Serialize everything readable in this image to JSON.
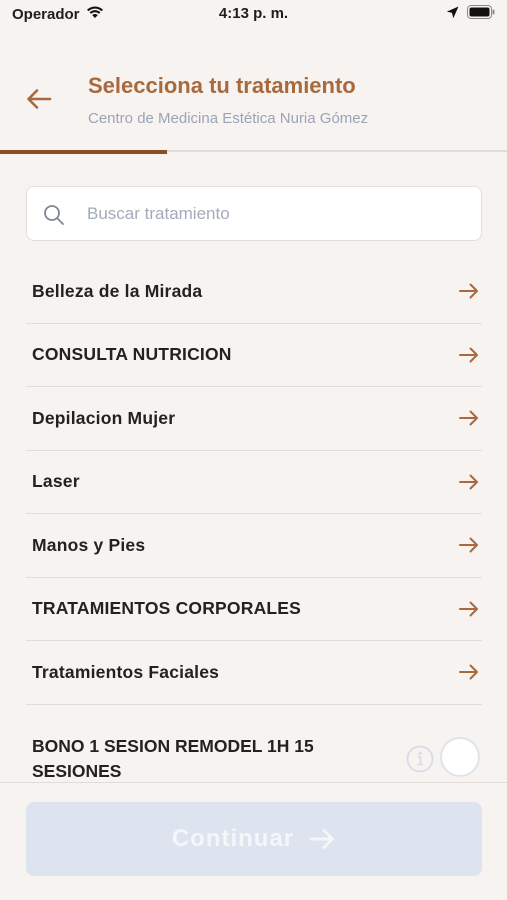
{
  "status_bar": {
    "carrier": "Operador",
    "time": "4:13 p. m."
  },
  "header": {
    "title": "Selecciona tu tratamiento",
    "subtitle": "Centro de Medicina Estética Nuria Gómez",
    "progress": 0.33
  },
  "search": {
    "placeholder": "Buscar tratamiento",
    "value": ""
  },
  "categories": [
    {
      "label": "Belleza de la Mirada"
    },
    {
      "label": "CONSULTA NUTRICION"
    },
    {
      "label": "Depilacion Mujer"
    },
    {
      "label": "Laser"
    },
    {
      "label": "Manos y Pies"
    },
    {
      "label": "TRATAMIENTOS CORPORALES"
    },
    {
      "label": "Tratamientos Faciales"
    }
  ],
  "bono_item": {
    "label": "BONO 1 SESION REMODEL 1H 15 SESIONES"
  },
  "footer": {
    "continue_label": "Continuar"
  },
  "colors": {
    "accent": "#a8693c",
    "accent_dark": "#8a4f23",
    "background": "#f7f3f1",
    "disabled_button": "#dde3ef"
  },
  "icons": {
    "back": "arrow-left-icon",
    "search": "search-icon",
    "row_arrow": "arrow-right-icon",
    "info": "info-icon",
    "wifi": "wifi-icon",
    "location": "location-arrow-icon",
    "battery": "battery-icon"
  }
}
